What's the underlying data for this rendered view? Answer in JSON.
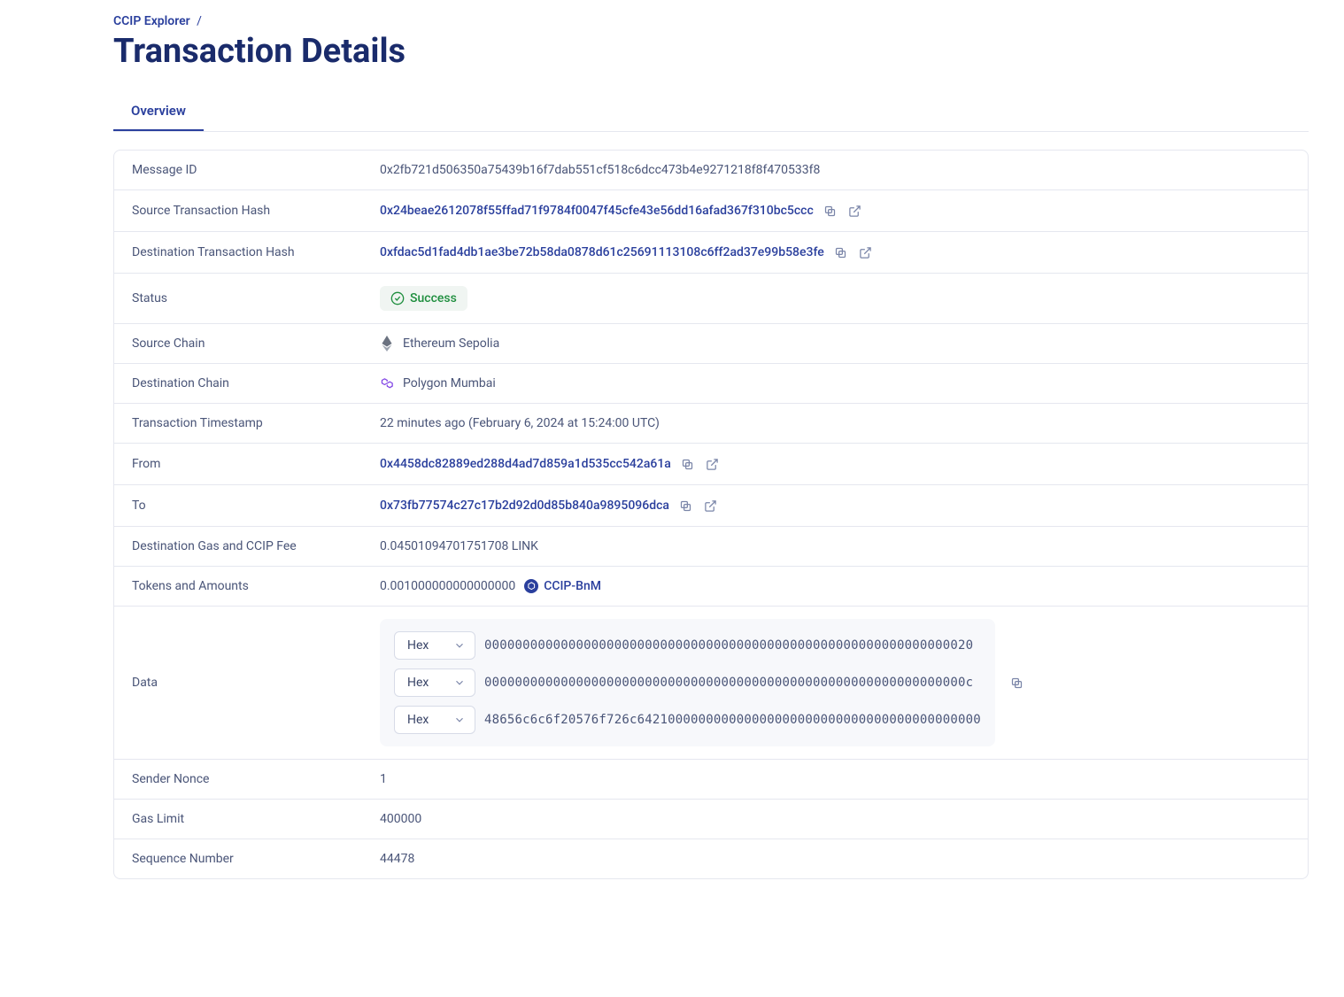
{
  "breadcrumb": {
    "parent": "CCIP Explorer",
    "sep": "/"
  },
  "page_title": "Transaction Details",
  "tabs": {
    "overview": "Overview"
  },
  "labels": {
    "message_id": "Message ID",
    "src_tx": "Source Transaction Hash",
    "dst_tx": "Destination Transaction Hash",
    "status": "Status",
    "src_chain": "Source Chain",
    "dst_chain": "Destination Chain",
    "timestamp": "Transaction Timestamp",
    "from": "From",
    "to": "To",
    "gas_fee": "Destination Gas and CCIP Fee",
    "tokens": "Tokens and Amounts",
    "data": "Data",
    "nonce": "Sender Nonce",
    "gas_limit": "Gas Limit",
    "seq": "Sequence Number"
  },
  "values": {
    "message_id": "0x2fb721d506350a75439b16f7dab551cf518c6dcc473b4e9271218f8f470533f8",
    "src_tx": "0x24beae2612078f55ffad71f9784f0047f45cfe43e56dd16afad367f310bc5ccc",
    "dst_tx": "0xfdac5d1fad4db1ae3be72b58da0878d61c25691113108c6ff2ad37e99b58e3fe",
    "status": "Success",
    "src_chain": "Ethereum Sepolia",
    "dst_chain": "Polygon Mumbai",
    "timestamp": "22 minutes ago (February 6, 2024 at 15:24:00 UTC)",
    "from": "0x4458dc82889ed288d4ad7d859a1d535cc542a61a",
    "to": "0x73fb77574c27c17b2d92d0d85b840a9895096dca",
    "gas_fee": "0.04501094701751708 LINK",
    "token_amount": "0.001000000000000000",
    "token_symbol": "CCIP-BnM",
    "nonce": "1",
    "gas_limit": "400000",
    "seq": "44478"
  },
  "data_block": {
    "select_label": "Hex",
    "lines": [
      "0000000000000000000000000000000000000000000000000000000000000020",
      "000000000000000000000000000000000000000000000000000000000000000c",
      "48656c6c6f20576f726c642100000000000000000000000000000000000000000"
    ]
  }
}
